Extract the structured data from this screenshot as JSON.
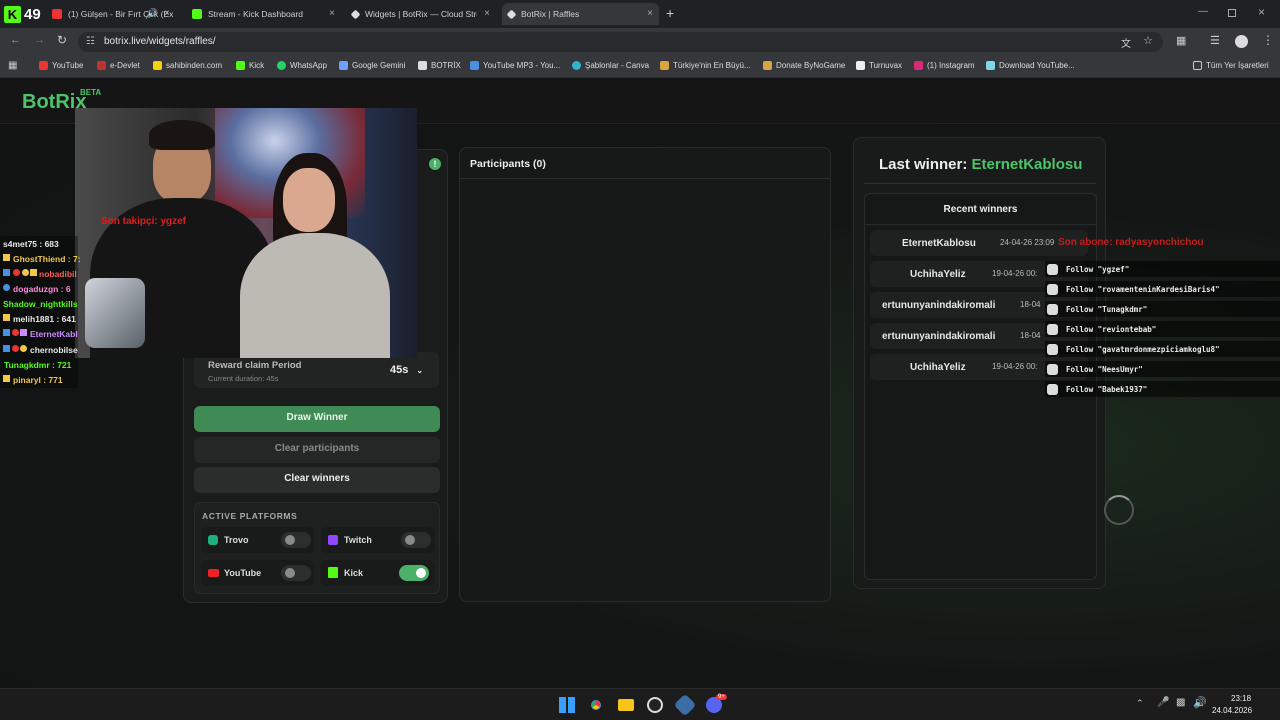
{
  "tabs": [
    {
      "label": "(1) Gülşen - Bir Fırt Çek (Ex",
      "color": "#e33"
    },
    {
      "label": "Stream - Kick Dashboard",
      "color": "#53fc18"
    },
    {
      "label": "Widgets | BotRix — Cloud Strea",
      "color": "#ddd"
    },
    {
      "label": "BotRix | Raffles",
      "color": "#ddd"
    }
  ],
  "kick_badge": "49",
  "address": "botrix.live/widgets/raffles/",
  "bookmarks": [
    "YouTube",
    "e-Devlet",
    "sahibinden.com",
    "Kick",
    "WhatsApp",
    "Google Gemini",
    "BOTRİX",
    "YouTube MP3 - You...",
    "Şablonlar - Canva",
    "Türkiye'nin En Büyü...",
    "Donate ByNoGame",
    "Turnuvax",
    "(1) Instagram",
    "Download YouTube..."
  ],
  "all_bookmarks": "Tüm Yer İşaretleri",
  "site": {
    "logo": "BotRix",
    "beta": "BETA"
  },
  "webcam_overlay_text": "Son takipçi: ygzef",
  "raffle": {
    "reward_label": "Reward claim Period",
    "reward_sub": "Current duration: 45s",
    "reward_value": "45s",
    "draw_btn": "Draw Winner",
    "clear_participants_btn": "Clear participants",
    "clear_winners_btn": "Clear winners",
    "platforms_title": "ACTIVE PLATFORMS",
    "platforms": [
      {
        "name": "Trovo",
        "on": false,
        "color": "#1fb080"
      },
      {
        "name": "Twitch",
        "on": false,
        "color": "#9146ff"
      },
      {
        "name": "YouTube",
        "on": false,
        "color": "#e22"
      },
      {
        "name": "Kick",
        "on": true,
        "color": "#53fc18"
      }
    ]
  },
  "participants_title": "Participants (0)",
  "winners": {
    "last_label": "Last winner:",
    "last_name": "EternetKablosu",
    "recent_title": "Recent winners",
    "rows": [
      {
        "name": "EternetKablosu",
        "date": "24-04-26 23:09"
      },
      {
        "name": "UchihaYeliz",
        "date": "19-04-26 00:"
      },
      {
        "name": "ertununyanindakiromali",
        "date": "18-04"
      },
      {
        "name": "ertununyanindakiromali",
        "date": "18-04"
      },
      {
        "name": "UchihaYeliz",
        "date": "19-04-26 00:"
      }
    ]
  },
  "sub_overlay": "Son abone: radyasyonchichou",
  "follows": [
    "Follow \"ygzef\"",
    "Follow \"rovamenteninKardesiBaris4\"",
    "Follow \"Tunagkdmr\"",
    "Follow \"reviontebab\"",
    "Follow \"gavatmrdonmezpiciamkoglu8\"",
    "Follow \"NeesUmyr\"",
    "Follow \"Babek1937\""
  ],
  "chat": [
    {
      "text": "s4met75 : 683",
      "color": "#e8e8e8"
    },
    {
      "text": "GhostThiend : 7:",
      "color": "#f2c84b"
    },
    {
      "text": "nobadibil",
      "color": "#ff5c5c"
    },
    {
      "text": "dogaduzgn : 6",
      "color": "#ff8ad8"
    },
    {
      "text": "Shadow_nightkills",
      "color": "#53fc18"
    },
    {
      "text": "melih1881 : 641",
      "color": "#e8e8e8"
    },
    {
      "text": "EternetKabl",
      "color": "#c98cff"
    },
    {
      "text": "chernobilse",
      "color": "#e8e8e8"
    },
    {
      "text": "Tunagkdmr : 721",
      "color": "#53fc18"
    },
    {
      "text": "pinaryl : 771",
      "color": "#f2c84b"
    }
  ],
  "taskbar": {
    "time": "23:18",
    "date": "24.04.2026",
    "notif": "9+"
  }
}
